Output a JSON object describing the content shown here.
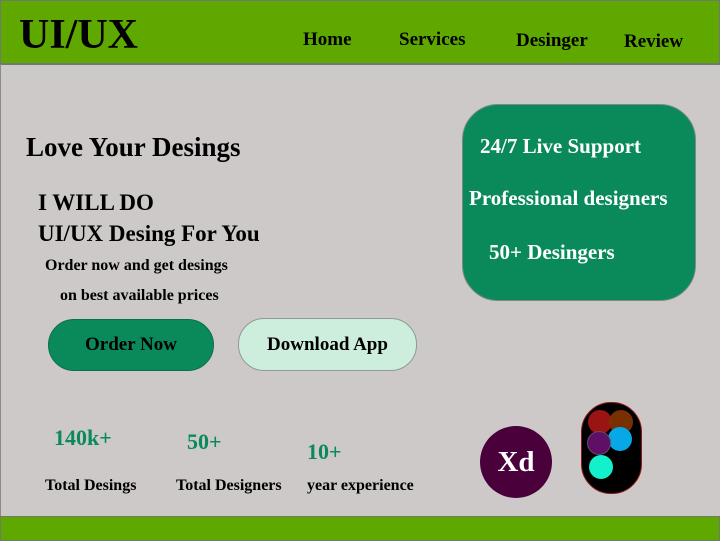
{
  "header": {
    "logo": "UI/UX",
    "nav": [
      {
        "label": "Home"
      },
      {
        "label": "Services"
      },
      {
        "label": "Desinger"
      },
      {
        "label": "Review"
      }
    ]
  },
  "hero": {
    "title": "Love Your Desings",
    "line1": "I WILL DO",
    "line2": "UI/UX Desing For You",
    "sub1": "Order now and get desings",
    "sub2": "on best available prices",
    "order_button": "Order Now",
    "download_button": "Download App"
  },
  "features": {
    "items": [
      "24/7 Live Support",
      "Professional designers",
      "50+ Desingers"
    ]
  },
  "stats": [
    {
      "value": "140k+",
      "label": "Total Desings"
    },
    {
      "value": "50+",
      "label": "Total Designers"
    },
    {
      "value": "10+",
      "label": "year experience"
    }
  ],
  "apps": {
    "xd_label": "Xd",
    "xd_icon": "adobe-xd-icon",
    "figma_icon": "figma-icon"
  },
  "colors": {
    "header_green": "#5fa800",
    "accent_green": "#0a8a5a",
    "background": "#cdc9c8",
    "download_bg": "#cdeedd",
    "xd_purple": "#4a003a"
  }
}
